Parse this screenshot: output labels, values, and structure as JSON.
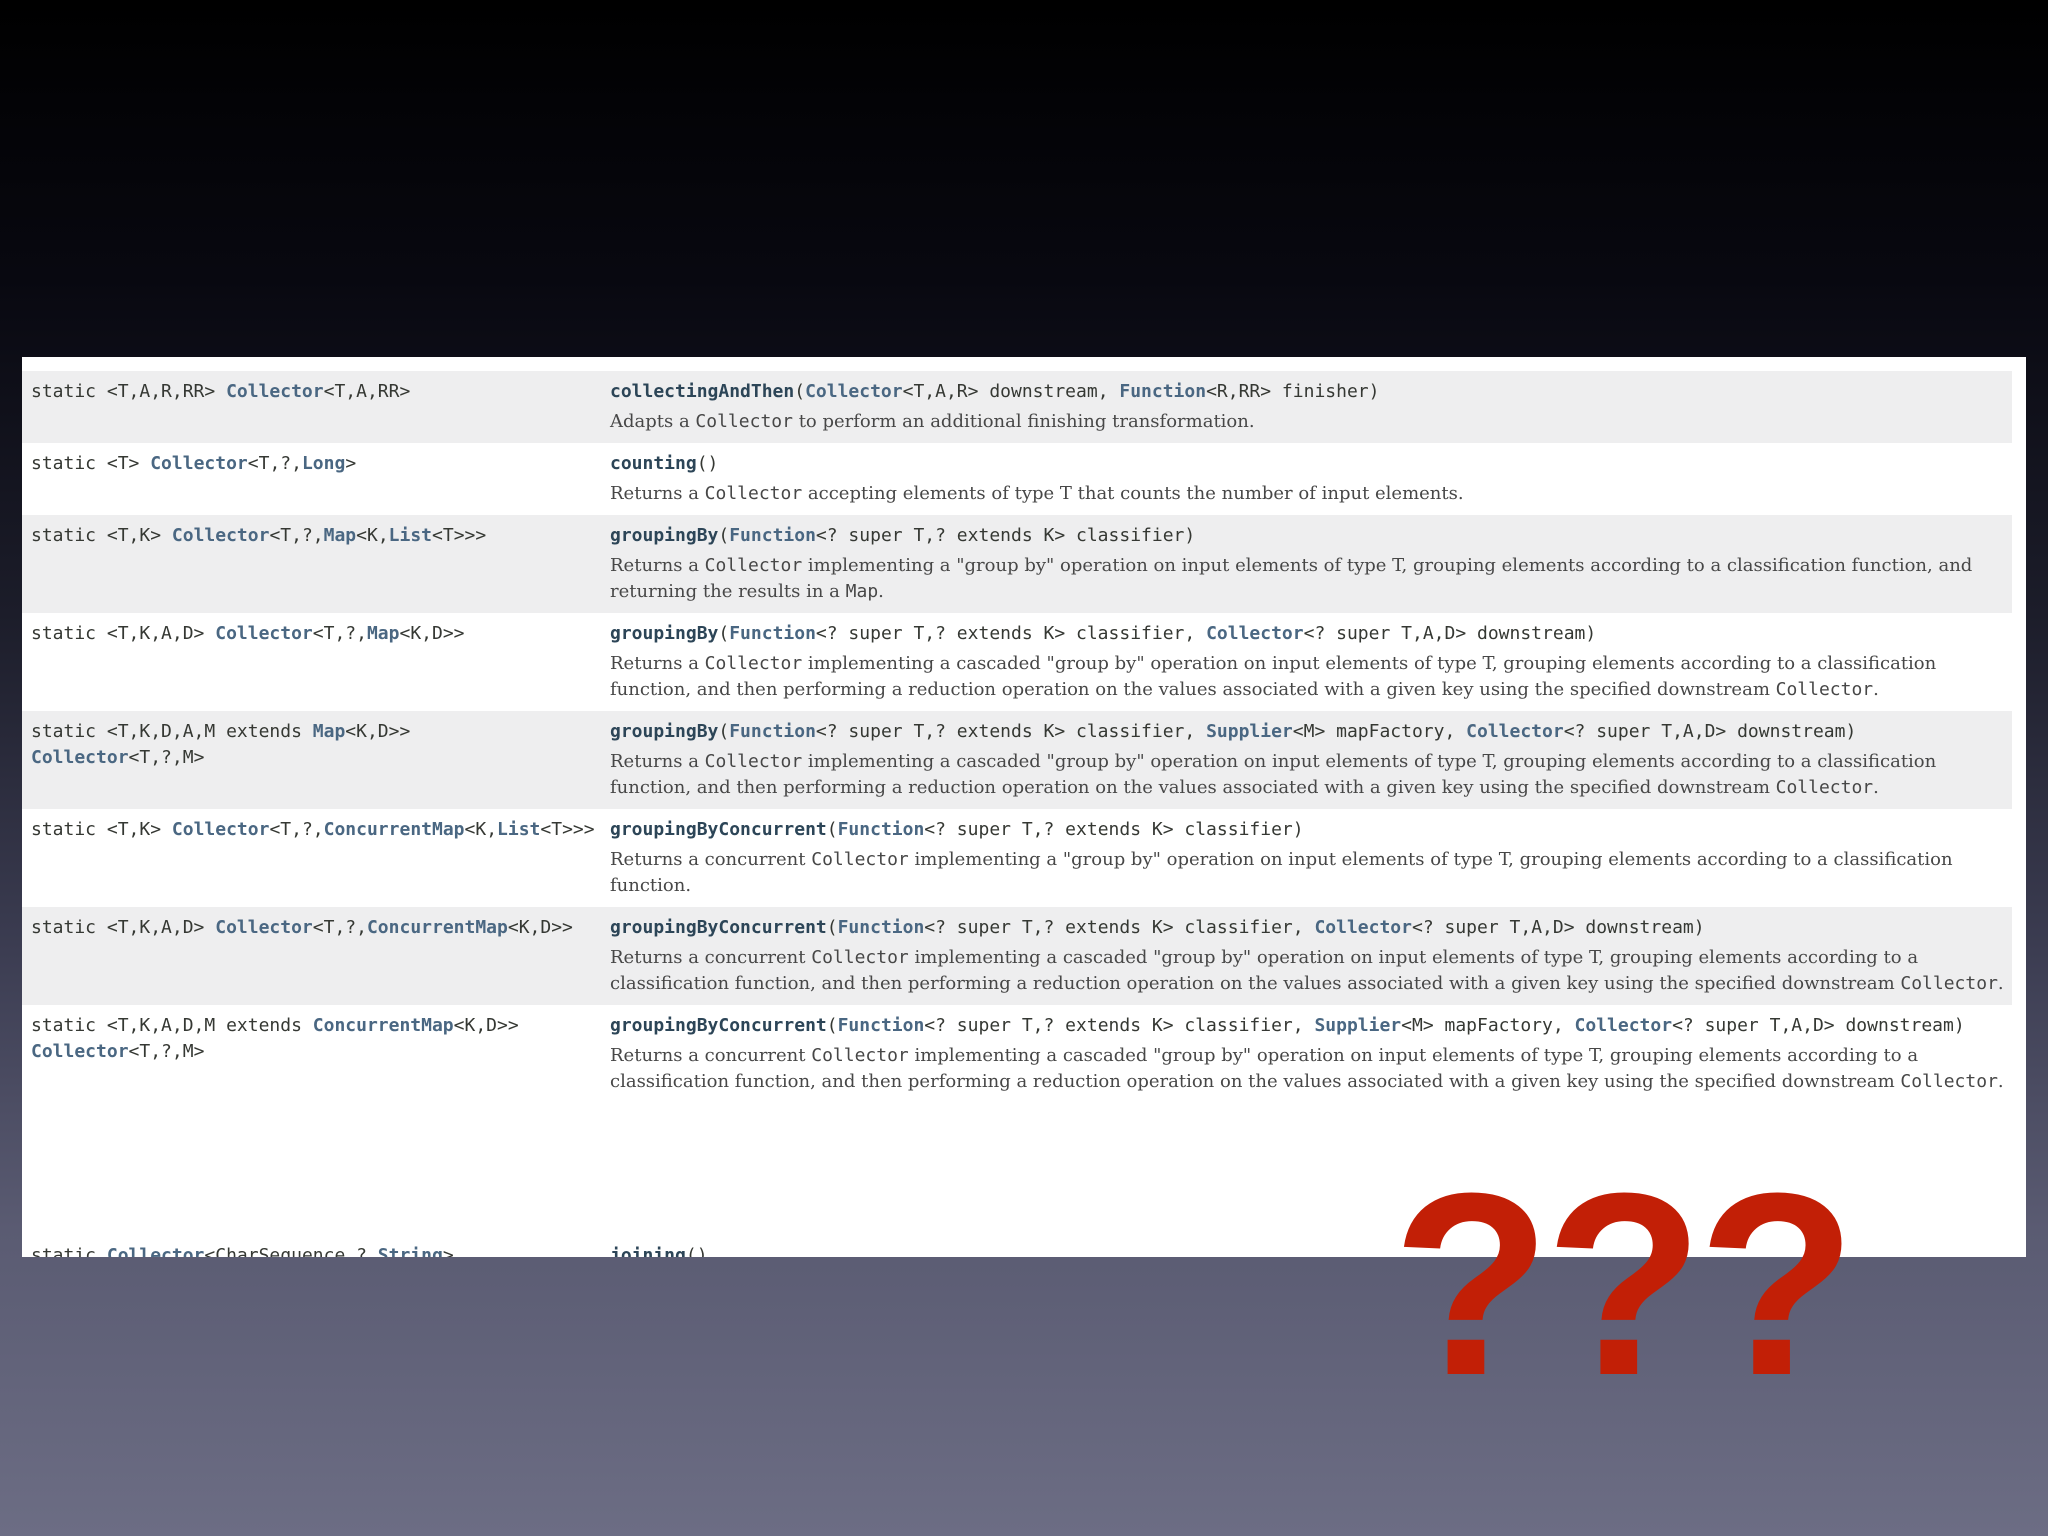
{
  "rows": [
    {
      "sig": [
        {
          "t": "static <T,A,R,RR> "
        },
        {
          "t": "Collector",
          "link": true
        },
        {
          "t": "<T,A,RR>"
        }
      ],
      "meth": [
        {
          "t": "collectingAndThen",
          "m": true
        },
        {
          "t": "("
        },
        {
          "t": "Collector",
          "link": true
        },
        {
          "t": "<T,A,R> downstream, "
        },
        {
          "t": "Function",
          "link": true
        },
        {
          "t": "<R,RR> finisher)"
        }
      ],
      "desc": [
        {
          "t": "Adapts a "
        },
        {
          "t": "Collector",
          "code": true
        },
        {
          "t": " to perform an additional finishing transformation."
        }
      ]
    },
    {
      "sig": [
        {
          "t": "static <T> "
        },
        {
          "t": "Collector",
          "link": true
        },
        {
          "t": "<T,?,"
        },
        {
          "t": "Long",
          "link": true
        },
        {
          "t": ">"
        }
      ],
      "meth": [
        {
          "t": "counting",
          "m": true
        },
        {
          "t": "()"
        }
      ],
      "desc": [
        {
          "t": "Returns a "
        },
        {
          "t": "Collector",
          "code": true
        },
        {
          "t": " accepting elements of type T that counts the number of input elements."
        }
      ]
    },
    {
      "sig": [
        {
          "t": "static <T,K> "
        },
        {
          "t": "Collector",
          "link": true
        },
        {
          "t": "<T,?,"
        },
        {
          "t": "Map",
          "link": true
        },
        {
          "t": "<K,"
        },
        {
          "t": "List",
          "link": true
        },
        {
          "t": "<T>>>"
        }
      ],
      "meth": [
        {
          "t": "groupingBy",
          "m": true
        },
        {
          "t": "("
        },
        {
          "t": "Function",
          "link": true
        },
        {
          "t": "<? super T,? extends K> classifier)"
        }
      ],
      "desc": [
        {
          "t": "Returns a "
        },
        {
          "t": "Collector",
          "code": true
        },
        {
          "t": " implementing a \"group by\" operation on input elements of type T, grouping elements according to a classification function, and returning the results in a "
        },
        {
          "t": "Map",
          "code": true
        },
        {
          "t": "."
        }
      ]
    },
    {
      "sig": [
        {
          "t": "static <T,K,A,D> "
        },
        {
          "t": "Collector",
          "link": true
        },
        {
          "t": "<T,?,"
        },
        {
          "t": "Map",
          "link": true
        },
        {
          "t": "<K,D>>"
        }
      ],
      "meth": [
        {
          "t": "groupingBy",
          "m": true
        },
        {
          "t": "("
        },
        {
          "t": "Function",
          "link": true
        },
        {
          "t": "<? super T,? extends K> classifier, "
        },
        {
          "t": "Collector",
          "link": true
        },
        {
          "t": "<? super T,A,D> downstream)"
        }
      ],
      "desc": [
        {
          "t": "Returns a "
        },
        {
          "t": "Collector",
          "code": true
        },
        {
          "t": " implementing a cascaded \"group by\" operation on input elements of type T, grouping elements according to a classification function, and then performing a reduction operation on the values associated with a given key using the specified downstream "
        },
        {
          "t": "Collector",
          "code": true
        },
        {
          "t": "."
        }
      ]
    },
    {
      "sig": [
        {
          "t": "static <T,K,D,A,M extends "
        },
        {
          "t": "Map",
          "link": true
        },
        {
          "t": "<K,D>>"
        },
        {
          "br": true
        },
        {
          "t": "Collector",
          "link": true
        },
        {
          "t": "<T,?,M>"
        }
      ],
      "meth": [
        {
          "t": "groupingBy",
          "m": true
        },
        {
          "t": "("
        },
        {
          "t": "Function",
          "link": true
        },
        {
          "t": "<? super T,? extends K> classifier, "
        },
        {
          "t": "Supplier",
          "link": true
        },
        {
          "t": "<M> mapFactory, "
        },
        {
          "t": "Collector",
          "link": true
        },
        {
          "t": "<? super T,A,D> downstream)"
        }
      ],
      "desc": [
        {
          "t": "Returns a "
        },
        {
          "t": "Collector",
          "code": true
        },
        {
          "t": " implementing a cascaded \"group by\" operation on input elements of type T, grouping elements according to a classification function, and then performing a reduction operation on the values associated with a given key using the specified downstream "
        },
        {
          "t": "Collector",
          "code": true
        },
        {
          "t": "."
        }
      ]
    },
    {
      "sig": [
        {
          "t": "static <T,K> "
        },
        {
          "t": "Collector",
          "link": true
        },
        {
          "t": "<T,?,"
        },
        {
          "t": "ConcurrentMap",
          "link": true
        },
        {
          "t": "<K,"
        },
        {
          "t": "List",
          "link": true
        },
        {
          "t": "<T>>>"
        }
      ],
      "meth": [
        {
          "t": "groupingByConcurrent",
          "m": true
        },
        {
          "t": "("
        },
        {
          "t": "Function",
          "link": true
        },
        {
          "t": "<? super T,? extends K> classifier)"
        }
      ],
      "desc": [
        {
          "t": "Returns a concurrent "
        },
        {
          "t": "Collector",
          "code": true
        },
        {
          "t": " implementing a \"group by\" operation on input elements of type T, grouping elements according to a classification function."
        }
      ]
    },
    {
      "sig": [
        {
          "t": "static <T,K,A,D> "
        },
        {
          "t": "Collector",
          "link": true
        },
        {
          "t": "<T,?,"
        },
        {
          "t": "ConcurrentMap",
          "link": true
        },
        {
          "t": "<K,D>>"
        }
      ],
      "meth": [
        {
          "t": "groupingByConcurrent",
          "m": true
        },
        {
          "t": "("
        },
        {
          "t": "Function",
          "link": true
        },
        {
          "t": "<? super T,? extends K> classifier, "
        },
        {
          "t": "Collector",
          "link": true
        },
        {
          "t": "<? super T,A,D> downstream)"
        }
      ],
      "desc": [
        {
          "t": "Returns a concurrent "
        },
        {
          "t": "Collector",
          "code": true
        },
        {
          "t": " implementing a cascaded \"group by\" operation on input elements of type T, grouping elements according to a classification function, and then performing a reduction operation on the values associated with a given key using the specified downstream "
        },
        {
          "t": "Collector",
          "code": true
        },
        {
          "t": "."
        }
      ]
    },
    {
      "sig": [
        {
          "t": "static <T,K,A,D,M extends "
        },
        {
          "t": "ConcurrentMap",
          "link": true
        },
        {
          "t": "<K,D>>"
        },
        {
          "br": true
        },
        {
          "t": "Collector",
          "link": true
        },
        {
          "t": "<T,?,M>"
        }
      ],
      "meth": [
        {
          "t": "groupingByConcurrent",
          "m": true
        },
        {
          "t": "("
        },
        {
          "t": "Function",
          "link": true
        },
        {
          "t": "<? super T,? extends K> classifier, "
        },
        {
          "t": "Supplier",
          "link": true
        },
        {
          "t": "<M> mapFactory, "
        },
        {
          "t": "Collector",
          "link": true
        },
        {
          "t": "<? super T,A,D> downstream)"
        }
      ],
      "desc": [
        {
          "t": "Returns a concurrent "
        },
        {
          "t": "Collector",
          "code": true
        },
        {
          "t": " implementing a cascaded \"group by\" operation on input elements of type T, grouping elements according to a classification function, and then performing a reduction operation on the values associated with a given key using the specified downstream "
        },
        {
          "t": "Collector",
          "code": true
        },
        {
          "t": "."
        }
      ]
    }
  ],
  "partial_bottom": {
    "sig": [
      {
        "t": "static "
      },
      {
        "t": "Collector",
        "link": true
      },
      {
        "t": "<CharSequence,?,"
      },
      {
        "t": "String",
        "link": true
      },
      {
        "t": ">"
      }
    ],
    "meth": [
      {
        "t": "joining",
        "m": true
      },
      {
        "t": "()"
      }
    ]
  },
  "overlay": {
    "question_marks": "???",
    "color": "#c21f06"
  },
  "colors": {
    "type_link": "#4a6782",
    "method_name": "#2c4557",
    "row_alt_bg": "#eeeeef"
  }
}
